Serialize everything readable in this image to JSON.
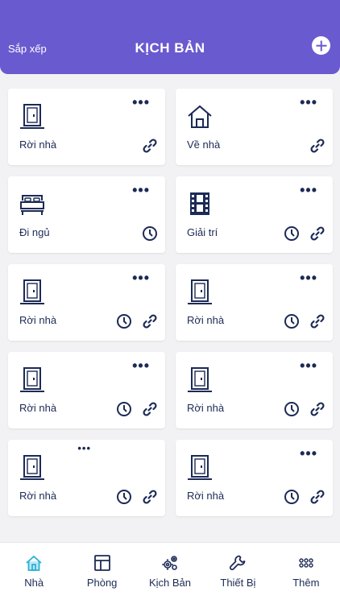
{
  "header": {
    "sort_label": "Sắp xếp",
    "title": "KỊCH BẢN"
  },
  "cards": [
    {
      "label": "Rời nhà",
      "icon": "door-icon",
      "timer": false,
      "link": true,
      "dots": "•••"
    },
    {
      "label": "Về nhà",
      "icon": "house-icon",
      "timer": false,
      "link": true,
      "dots": "•••"
    },
    {
      "label": "Đi ngủ",
      "icon": "bed-icon",
      "timer": true,
      "link": false,
      "dots": "•••"
    },
    {
      "label": "Giải trí",
      "icon": "film-icon",
      "timer": true,
      "link": true,
      "dots": "•••"
    },
    {
      "label": "Rời nhà",
      "icon": "door-icon",
      "timer": true,
      "link": true,
      "dots": "•••"
    },
    {
      "label": "Rời nhà",
      "icon": "door-icon",
      "timer": true,
      "link": true,
      "dots": "•••"
    },
    {
      "label": "Rời nhà",
      "icon": "door-icon",
      "timer": true,
      "link": true,
      "dots": "•••"
    },
    {
      "label": "Rời nhà",
      "icon": "door-icon",
      "timer": true,
      "link": true,
      "dots": "•••"
    },
    {
      "label": "Rời nhà",
      "icon": "door-icon",
      "timer": true,
      "link": true,
      "dots": "•••"
    },
    {
      "label": "Rời nhà",
      "icon": "door-icon",
      "timer": true,
      "link": true,
      "dots": "•••"
    }
  ],
  "tabs": [
    {
      "label": "Nhà",
      "icon": "home-icon",
      "active": true
    },
    {
      "label": "Phòng",
      "icon": "room-icon",
      "active": false
    },
    {
      "label": "Kịch Bản",
      "icon": "gears-icon",
      "active": false
    },
    {
      "label": "Thiết Bị",
      "icon": "wrench-icon",
      "active": false
    },
    {
      "label": "Thêm",
      "icon": "grid-dots-icon",
      "active": false
    }
  ],
  "colors": {
    "header": "#6a5ad0",
    "icon": "#1c2a55",
    "active_tab_icon": "#2ab0d8"
  }
}
